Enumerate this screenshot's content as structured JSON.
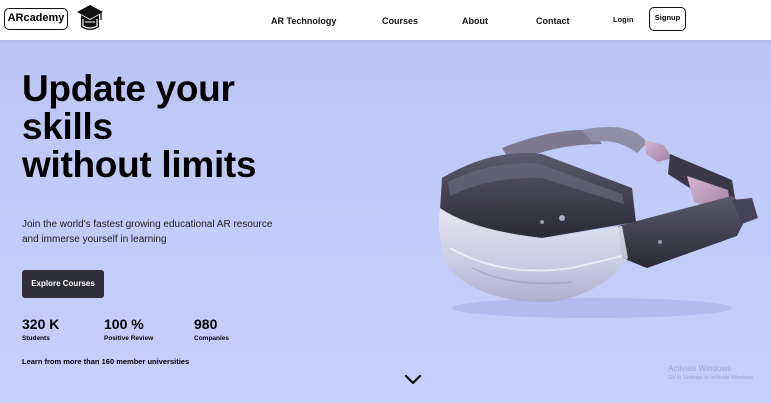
{
  "header": {
    "logo_text": "ARcademy",
    "logo_icon": "graduation-cap-icon",
    "nav": [
      "AR Technology",
      "Courses",
      "About",
      "Contact"
    ],
    "login": "Login",
    "signup": "Signup"
  },
  "hero": {
    "headline": [
      "Update your",
      "skills",
      "without limits"
    ],
    "subtext": [
      "Join the world's fastest growing educational AR resource",
      "and immerse yourself in learning"
    ],
    "cta": "Explore Courses",
    "stats": [
      {
        "value": "320 K",
        "label": "Students"
      },
      {
        "value": "100 %",
        "label": "Positive Review"
      },
      {
        "value": "980",
        "label": "Companies"
      }
    ],
    "universities": "Learn from more than 160 member universities",
    "scroll_icon": "chevron-down-icon"
  },
  "watermark": {
    "title": "Activate Windows",
    "subtitle": "Go to Settings to activate Windows."
  },
  "colors": {
    "background": "#c0cbf7",
    "button": "#2e2f3a",
    "header": "#ffffff"
  }
}
